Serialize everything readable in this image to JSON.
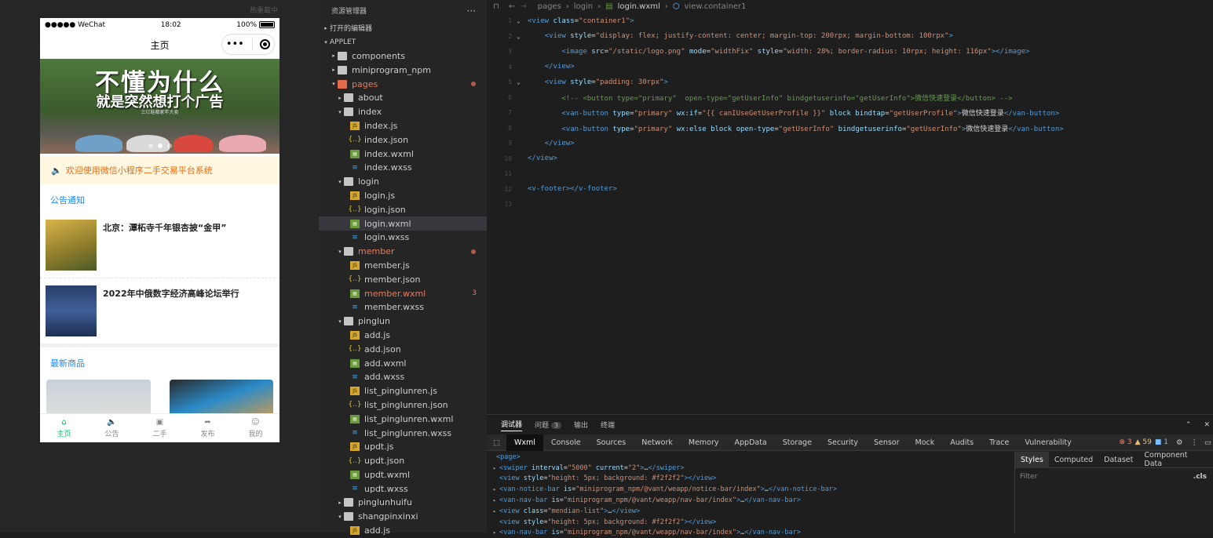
{
  "simulator": {
    "hot_reload": "热重载中",
    "status": {
      "carrier": "●●●●● WeChat",
      "time": "18:02",
      "battery": "100%"
    },
    "nav_title": "主页",
    "capsule_menu": "•••",
    "banner": {
      "line1": "不懂为什么",
      "line2": "就是突然想打个广告",
      "line3": "三亿鞋都家年大卖"
    },
    "notice": "欢迎使用微信小程序二手交易平台系统",
    "section_announcements": "公告通知",
    "news": [
      {
        "title": "北京：潭柘寺千年银杏披“金甲”"
      },
      {
        "title": "2022年中俄数字经济高峰论坛举行"
      }
    ],
    "section_goods": "最新商品",
    "tabbar": [
      {
        "label": "主页",
        "icon": "⌂"
      },
      {
        "label": "公告",
        "icon": "🔈"
      },
      {
        "label": "二手",
        "icon": "▣"
      },
      {
        "label": "发布",
        "icon": "➦"
      },
      {
        "label": "我的",
        "icon": "☺"
      }
    ]
  },
  "explorer": {
    "title": "资源管理器",
    "more": "···",
    "open_editors": "打开的编辑器",
    "project": "APPLET",
    "tree": [
      {
        "label": "components",
        "type": "folder",
        "depth": 1,
        "chev": "▸"
      },
      {
        "label": "miniprogram_npm",
        "type": "folder",
        "depth": 1,
        "chev": "▸"
      },
      {
        "label": "pages",
        "type": "folder-red",
        "depth": 1,
        "chev": "▾",
        "red": true,
        "dot": true
      },
      {
        "label": "about",
        "type": "folder",
        "depth": 2,
        "chev": "▸"
      },
      {
        "label": "index",
        "type": "folder",
        "depth": 2,
        "chev": "▾"
      },
      {
        "label": "index.js",
        "type": "js",
        "depth": 3
      },
      {
        "label": "index.json",
        "type": "json",
        "depth": 3
      },
      {
        "label": "index.wxml",
        "type": "wxml",
        "depth": 3
      },
      {
        "label": "index.wxss",
        "type": "wxss",
        "depth": 3
      },
      {
        "label": "login",
        "type": "folder",
        "depth": 2,
        "chev": "▾"
      },
      {
        "label": "login.js",
        "type": "js",
        "depth": 3
      },
      {
        "label": "login.json",
        "type": "json",
        "depth": 3
      },
      {
        "label": "login.wxml",
        "type": "wxml",
        "depth": 3,
        "selected": true
      },
      {
        "label": "login.wxss",
        "type": "wxss",
        "depth": 3
      },
      {
        "label": "member",
        "type": "folder",
        "depth": 2,
        "chev": "▾",
        "red": true,
        "dot": true
      },
      {
        "label": "member.js",
        "type": "js",
        "depth": 3
      },
      {
        "label": "member.json",
        "type": "json",
        "depth": 3
      },
      {
        "label": "member.wxml",
        "type": "wxml",
        "depth": 3,
        "red": true,
        "badge": "3"
      },
      {
        "label": "member.wxss",
        "type": "wxss",
        "depth": 3
      },
      {
        "label": "pinglun",
        "type": "folder",
        "depth": 2,
        "chev": "▾"
      },
      {
        "label": "add.js",
        "type": "js",
        "depth": 3
      },
      {
        "label": "add.json",
        "type": "json",
        "depth": 3
      },
      {
        "label": "add.wxml",
        "type": "wxml",
        "depth": 3
      },
      {
        "label": "add.wxss",
        "type": "wxss",
        "depth": 3
      },
      {
        "label": "list_pinglunren.js",
        "type": "js",
        "depth": 3
      },
      {
        "label": "list_pinglunren.json",
        "type": "json",
        "depth": 3
      },
      {
        "label": "list_pinglunren.wxml",
        "type": "wxml",
        "depth": 3
      },
      {
        "label": "list_pinglunren.wxss",
        "type": "wxss",
        "depth": 3
      },
      {
        "label": "updt.js",
        "type": "js",
        "depth": 3
      },
      {
        "label": "updt.json",
        "type": "json",
        "depth": 3
      },
      {
        "label": "updt.wxml",
        "type": "wxml",
        "depth": 3
      },
      {
        "label": "updt.wxss",
        "type": "wxss",
        "depth": 3
      },
      {
        "label": "pinglunhuifu",
        "type": "folder",
        "depth": 2,
        "chev": "▸"
      },
      {
        "label": "shangpinxinxi",
        "type": "folder",
        "depth": 2,
        "chev": "▾"
      },
      {
        "label": "add.js",
        "type": "js",
        "depth": 3
      }
    ]
  },
  "editor": {
    "breadcrumb": [
      "pages",
      "login",
      "login.wxml",
      "view.container1"
    ],
    "lines": [
      {
        "n": "1",
        "fold": "⌄",
        "html": "<span class='tg'>&lt;view</span> <span class='at'>class</span>=<span class='st'>\"container1\"</span><span class='tg'>&gt;</span>"
      },
      {
        "n": "2",
        "fold": "⌄",
        "html": "    <span class='tg'>&lt;view</span> <span class='at'>style</span>=<span class='st'>\"display: flex; justify-content: center; margin-top: 200rpx; margin-bottom: 100rpx\"</span><span class='tg'>&gt;</span>"
      },
      {
        "n": "3",
        "fold": "",
        "html": "        <span class='tg'>&lt;image</span> <span class='at'>src</span>=<span class='st'>\"/static/logo.png\"</span> <span class='at'>mode</span>=<span class='st'>\"widthFix\"</span> <span class='at'>style</span>=<span class='st'>\"width: 28%; border-radius: 10rpx; height: 116px\"</span><span class='tg'>&gt;&lt;/image&gt;</span>"
      },
      {
        "n": "4",
        "fold": "",
        "html": "    <span class='tg'>&lt;/view&gt;</span>"
      },
      {
        "n": "5",
        "fold": "⌄",
        "html": "    <span class='tg'>&lt;view</span> <span class='at'>style</span>=<span class='st'>\"padding: 30rpx\"</span><span class='tg'>&gt;</span>"
      },
      {
        "n": "6",
        "fold": "",
        "html": "        <span class='cm'>&lt;!-- &lt;button type=\"primary\"  open-type=\"getUserInfo\" bindgetuserinfo=\"getUserInfo\"&gt;微信快速登录&lt;/button&gt; --&gt;</span>"
      },
      {
        "n": "7",
        "fold": "",
        "html": "        <span class='tg'>&lt;van-button</span> <span class='at'>type</span>=<span class='st'>\"primary\"</span> <span class='at'>wx:if</span>=<span class='st'>\"{{ canIUseGetUserProfile }}\"</span> <span class='at'>block</span> <span class='at'>bindtap</span>=<span class='st'>\"getUserProfile\"</span><span class='tg'>&gt;</span><span class='cn'>微信快速登录</span><span class='tg'>&lt;/van-button&gt;</span>"
      },
      {
        "n": "8",
        "fold": "",
        "html": "        <span class='tg'>&lt;van-button</span> <span class='at'>type</span>=<span class='st'>\"primary\"</span> <span class='at'>wx:else</span> <span class='at'>block</span> <span class='at'>open-type</span>=<span class='st'>\"getUserInfo\"</span> <span class='at'>bindgetuserinfo</span>=<span class='st'>\"getUserInfo\"</span><span class='tg'>&gt;</span><span class='cn'>微信快速登录</span><span class='tg'>&lt;/van-button&gt;</span>"
      },
      {
        "n": "9",
        "fold": "",
        "html": "    <span class='tg'>&lt;/view&gt;</span>"
      },
      {
        "n": "10",
        "fold": "",
        "html": "<span class='tg'>&lt;/view&gt;</span>"
      },
      {
        "n": "11",
        "fold": "",
        "html": ""
      },
      {
        "n": "12",
        "fold": "",
        "html": "<span class='tg'>&lt;v-footer&gt;&lt;/v-footer&gt;</span>"
      },
      {
        "n": "13",
        "fold": "",
        "html": ""
      }
    ]
  },
  "devtools": {
    "top_tabs": {
      "debugger": "调试器",
      "problems": "问题",
      "problems_count": "3",
      "output": "输出",
      "terminal": "终端"
    },
    "panel_tabs": [
      "Wxml",
      "Console",
      "Sources",
      "Network",
      "Memory",
      "AppData",
      "Storage",
      "Security",
      "Sensor",
      "Mock",
      "Audits",
      "Trace",
      "Vulnerability"
    ],
    "errors": "3",
    "warnings": "59",
    "info": "1",
    "dom": [
      {
        "tri": "",
        "html": "<span class='tg'>&lt;page&gt;</span>"
      },
      {
        "tri": "▸",
        "html": "<span class='tg'>&lt;swiper</span> <span class='at'>interval</span>=<span class='st'>\"5000\"</span> <span class='at'>current</span>=<span class='st'>\"2\"</span><span class='tg'>&gt;</span>…<span class='tg'>&lt;/swiper&gt;</span>"
      },
      {
        "tri": "",
        "html": "<span class='tg'>&lt;view</span> <span class='at'>style</span>=<span class='st'>\"height: 5px; background: #f2f2f2\"</span><span class='tg'>&gt;&lt;/view&gt;</span>"
      },
      {
        "tri": "▸",
        "html": "<span class='tg'>&lt;van-notice-bar</span> <span class='at'>is</span>=<span class='st'>\"miniprogram_npm/@vant/weapp/notice-bar/index\"</span><span class='tg'>&gt;</span>…<span class='tg'>&lt;/van-notice-bar&gt;</span>"
      },
      {
        "tri": "▸",
        "html": "<span class='tg'>&lt;van-nav-bar</span> <span class='at'>is</span>=<span class='st'>\"miniprogram_npm/@vant/weapp/nav-bar/index\"</span><span class='tg'>&gt;</span>…<span class='tg'>&lt;/van-nav-bar&gt;</span>"
      },
      {
        "tri": "▸",
        "html": "<span class='tg'>&lt;view</span> <span class='at'>class</span>=<span class='st'>\"mendian-list\"</span><span class='tg'>&gt;</span>…<span class='tg'>&lt;/view&gt;</span>"
      },
      {
        "tri": "",
        "html": "<span class='tg'>&lt;view</span> <span class='at'>style</span>=<span class='st'>\"height: 5px; background: #f2f2f2\"</span><span class='tg'>&gt;&lt;/view&gt;</span>"
      },
      {
        "tri": "▸",
        "html": "<span class='tg'>&lt;van-nav-bar</span> <span class='at'>is</span>=<span class='st'>\"miniprogram_npm/@vant/weapp/nav-bar/index\"</span><span class='tg'>&gt;</span>…<span class='tg'>&lt;/van-nav-bar&gt;</span>"
      }
    ],
    "styles_tabs": [
      "Styles",
      "Computed",
      "Dataset",
      "Component Data"
    ],
    "filter_placeholder": "Filter",
    "cls": ".cls"
  }
}
